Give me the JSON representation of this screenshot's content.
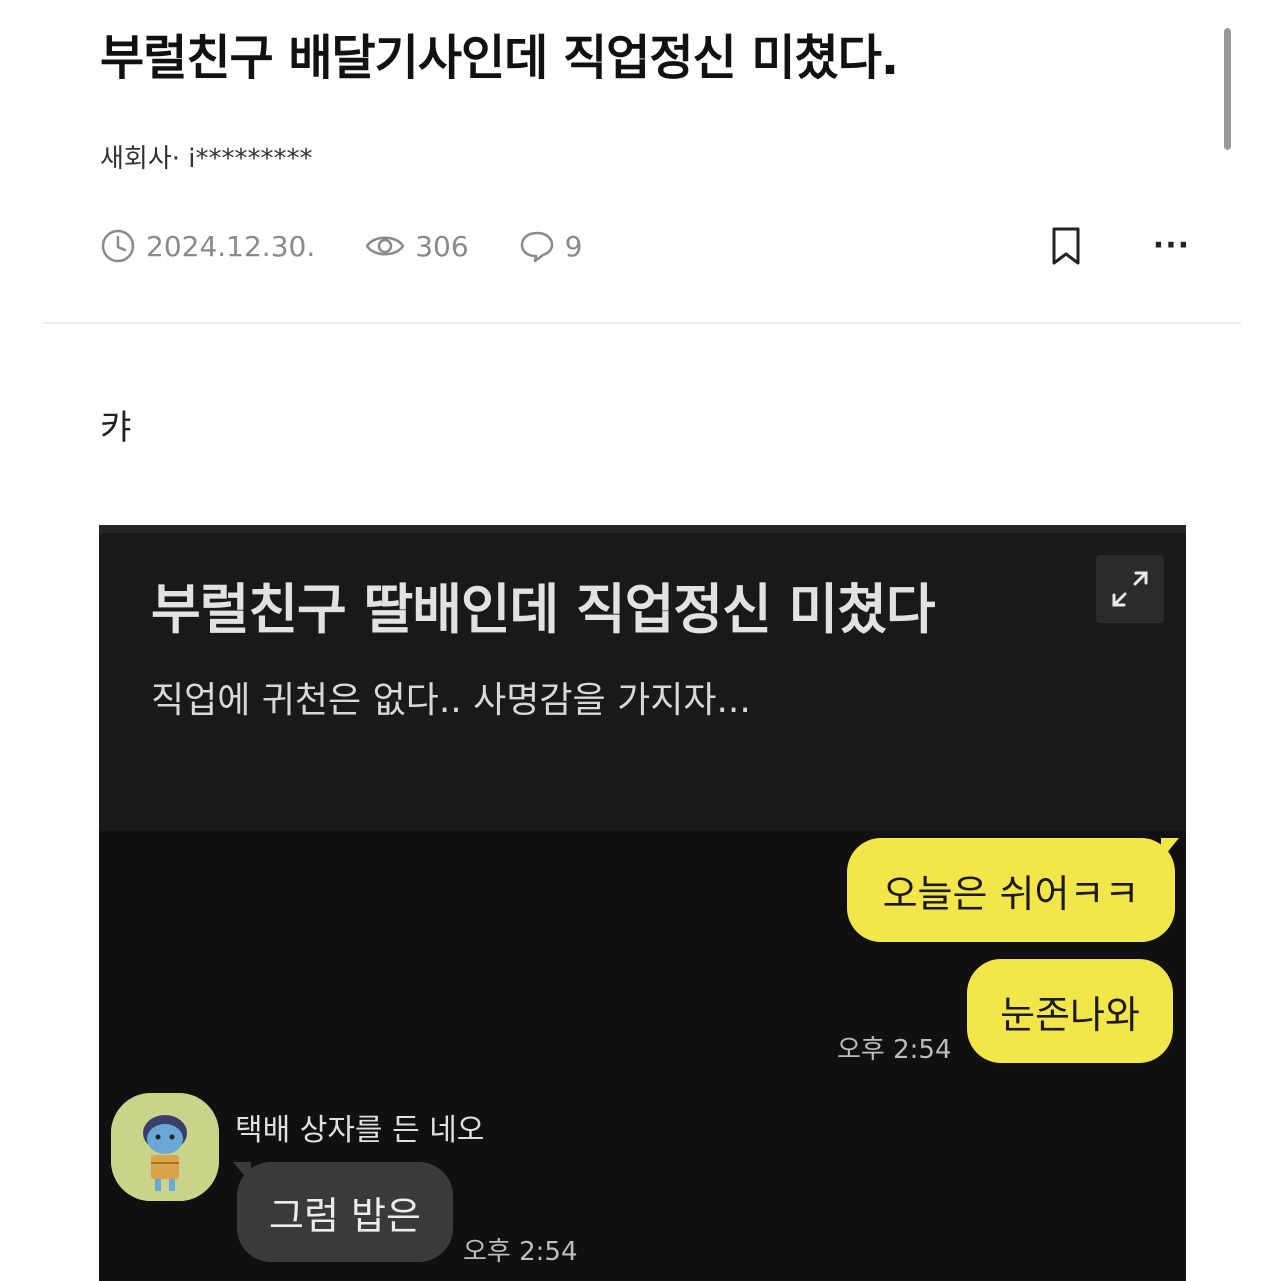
{
  "post": {
    "title": "부럴친구 배달기사인데 직업정신 미쳤다.",
    "author": "새회사· i*********",
    "date": "2024.12.30.",
    "views": "306",
    "comments": "9",
    "more_label": "···",
    "body_text": "캬"
  },
  "icons": {
    "date": "clock-icon",
    "views": "eye-icon",
    "comments": "comment-icon",
    "bookmark": "bookmark-icon",
    "more": "more-icon",
    "expand": "expand-icon"
  },
  "embed": {
    "title": "부럴친구 딸배인데 직업정신 미쳤다",
    "subtitle": "직업에 귀천은 없다.. 사명감을 가지자...",
    "messages": [
      {
        "side": "me",
        "text": "오늘은 쉬어ㅋㅋ"
      },
      {
        "side": "me",
        "text": "눈존나와",
        "time": "오후 2:54"
      },
      {
        "side": "other",
        "sender": "택배 상자를 든 네오",
        "text": "그럼 밥은",
        "time": "오후 2:54"
      }
    ]
  },
  "colors": {
    "accent_yellow": "#f3e64b",
    "dark_bg": "#101010",
    "meta_gray": "#8a8a8a"
  }
}
